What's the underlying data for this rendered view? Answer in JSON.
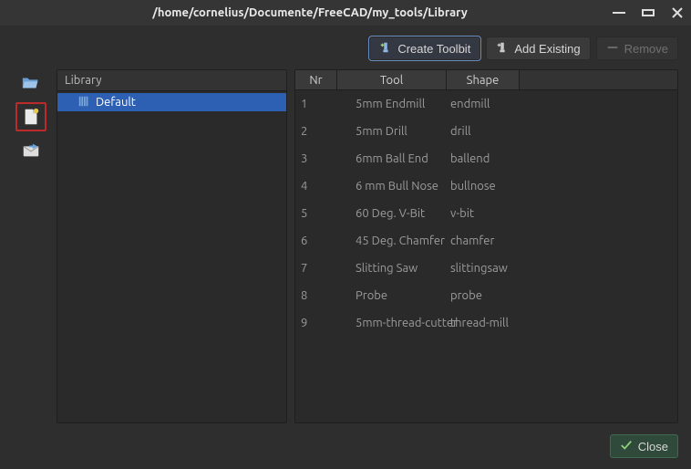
{
  "window": {
    "title": "/home/cornelius/Documente/FreeCAD/my_tools/Library"
  },
  "toolbar": {
    "create_label": "Create Toolbit",
    "add_existing_label": "Add Existing",
    "remove_label": "Remove"
  },
  "library_panel": {
    "header": "Library",
    "items": [
      {
        "label": "Default",
        "selected": true
      }
    ]
  },
  "table": {
    "headers": {
      "nr": "Nr",
      "tool": "Tool",
      "shape": "Shape"
    },
    "rows": [
      {
        "nr": "1",
        "tool": "5mm Endmill",
        "shape": "endmill"
      },
      {
        "nr": "2",
        "tool": "5mm Drill",
        "shape": "drill"
      },
      {
        "nr": "3",
        "tool": "6mm Ball End",
        "shape": "ballend"
      },
      {
        "nr": "4",
        "tool": "6 mm Bull Nose",
        "shape": "bullnose"
      },
      {
        "nr": "5",
        "tool": "60 Deg. V-Bit",
        "shape": "v-bit"
      },
      {
        "nr": "6",
        "tool": "45 Deg. Chamfer",
        "shape": "chamfer"
      },
      {
        "nr": "7",
        "tool": "Slitting Saw",
        "shape": "slittingsaw"
      },
      {
        "nr": "8",
        "tool": "Probe",
        "shape": "probe"
      },
      {
        "nr": "9",
        "tool": "5mm-thread-cutter",
        "shape": "thread-mill"
      }
    ]
  },
  "footer": {
    "close_label": "Close"
  },
  "colors": {
    "selection": "#2d5fb3",
    "frame_highlight": "#bb2b2b",
    "primary_button": "#2f4a3a"
  }
}
